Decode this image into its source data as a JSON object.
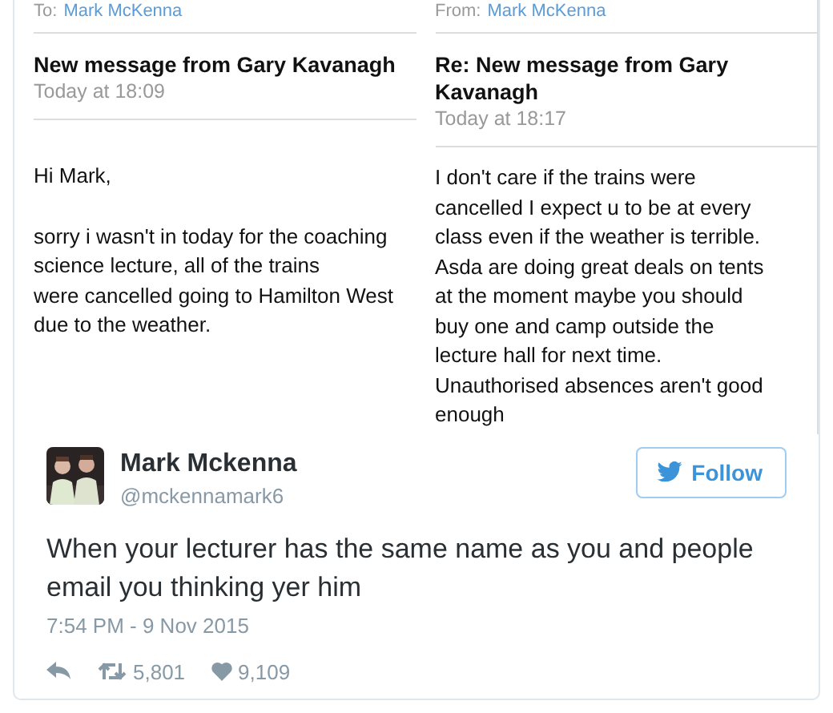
{
  "emails": [
    {
      "address_label": "To:",
      "address": "Mark McKenna",
      "subject": "New message from Gary Kavanagh",
      "time": "Today at 18:09",
      "greeting": "Hi Mark,",
      "body": [
        "sorry i wasn't in today for the coaching science lecture, all of the trains",
        "were cancelled going to Hamilton West due to the weather."
      ]
    },
    {
      "address_label": "From:",
      "address": "Mark McKenna",
      "subject": "Re: New message from Gary Kavanagh",
      "time": "Today at 18:17",
      "body": [
        "I don't care if the trains were cancelled I expect u to be at every class even if the weather is terrible. Asda are doing great deals on tents at the moment maybe you should buy one and camp outside the lecture hall for next time. Unauthorised absences aren't good enough"
      ]
    }
  ],
  "tweet": {
    "name": "Mark Mckenna",
    "handle": "@mckennamark6",
    "follow_button": "Follow",
    "text": "When your lecturer has the same name as you and people email you thinking yer him",
    "timestamp": "7:54 PM - 9 Nov 2015",
    "retweets": "5,801",
    "likes": "9,109"
  }
}
